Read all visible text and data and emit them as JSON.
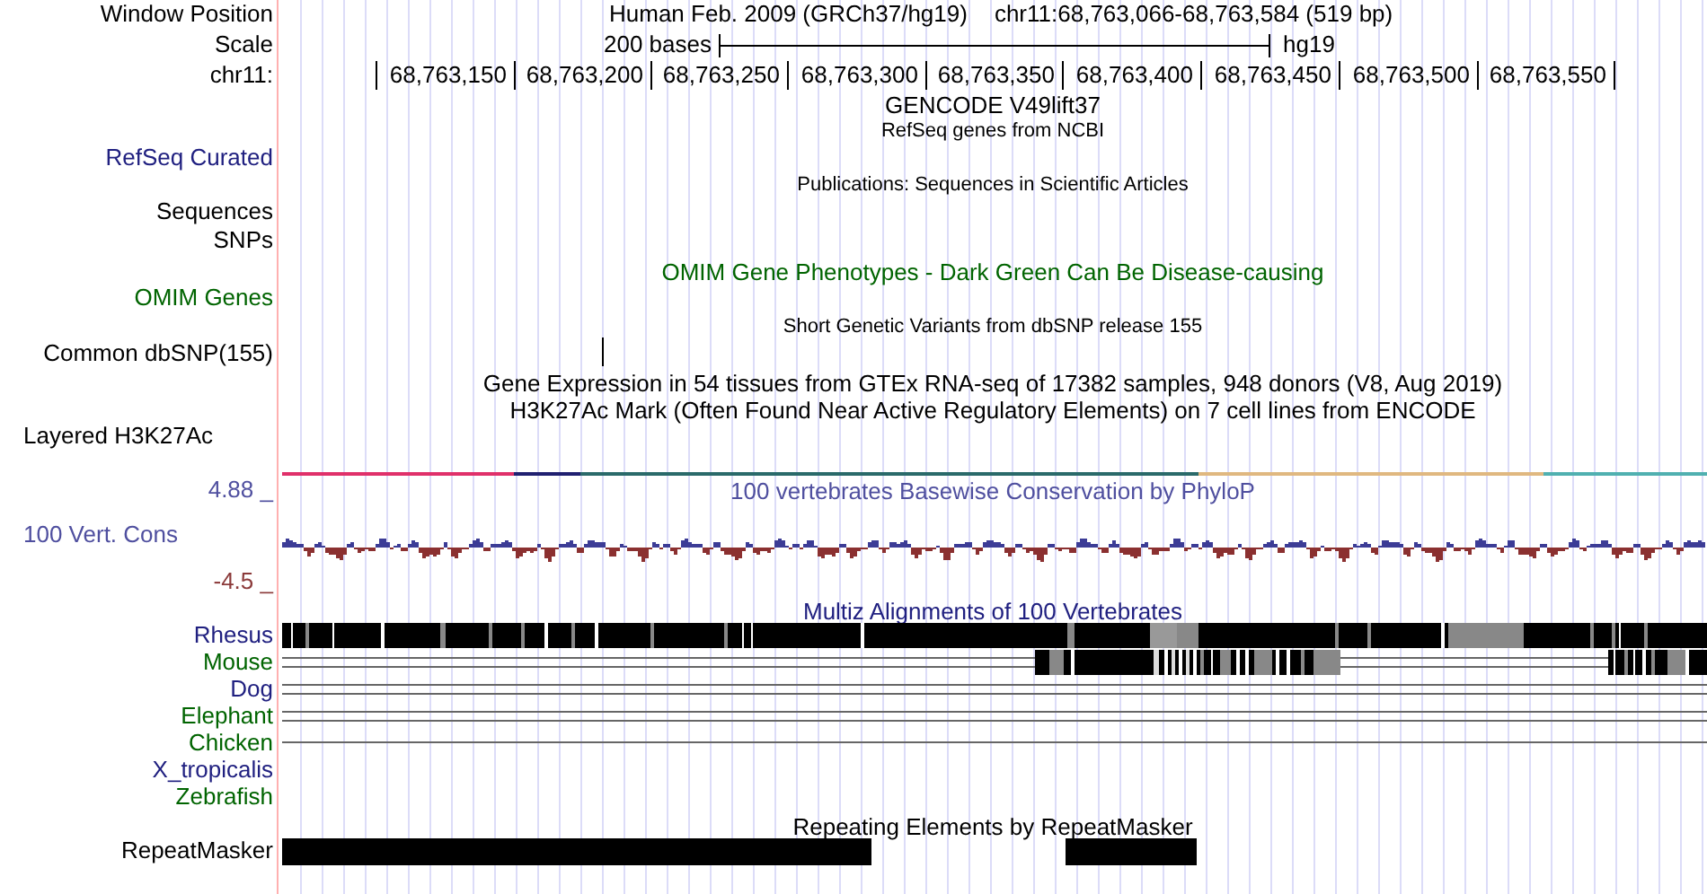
{
  "header": {
    "window_position_label": "Window Position",
    "assembly": "Human Feb. 2009 (GRCh37/hg19)",
    "position": "chr11:68,763,066-68,763,584 (519 bp)",
    "scale_label": "Scale",
    "scale_text": "200 bases",
    "scale_db": "hg19",
    "ruler_label": "chr11:",
    "ruler_ticks": [
      "68,763,150",
      "68,763,200",
      "68,763,250",
      "68,763,300",
      "68,763,350",
      "68,763,400",
      "68,763,450",
      "68,763,500",
      "68,763,550"
    ]
  },
  "track_labels": [
    {
      "text": "RefSeq Curated",
      "color": "#202080"
    },
    {
      "text": "Sequences",
      "color": "#000000"
    },
    {
      "text": "SNPs",
      "color": "#000000"
    },
    {
      "text": "OMIM Genes",
      "color": "#006400"
    },
    {
      "text": "Common dbSNP(155)",
      "color": "#000000"
    },
    {
      "text": "Layered H3K27Ac",
      "color": "#000000"
    },
    {
      "text": "4.88 _",
      "color": "#4f4f9f"
    },
    {
      "text": "100 Vert. Cons",
      "color": "#4f4f9f"
    },
    {
      "text": "-4.5 _",
      "color": "#8b3a3a"
    },
    {
      "text": "Rhesus",
      "color": "#202080"
    },
    {
      "text": "Mouse",
      "color": "#006400"
    },
    {
      "text": "Dog",
      "color": "#202080"
    },
    {
      "text": "Elephant",
      "color": "#006400"
    },
    {
      "text": "Chicken",
      "color": "#006400"
    },
    {
      "text": "X_tropicalis",
      "color": "#202080"
    },
    {
      "text": "Zebrafish",
      "color": "#006400"
    },
    {
      "text": "RepeatMasker",
      "color": "#000000"
    }
  ],
  "track_titles": [
    {
      "text": "GENCODE V49lift37",
      "color": "#000000"
    },
    {
      "text": "RefSeq genes from NCBI",
      "color": "#000000"
    },
    {
      "text": "Publications: Sequences in Scientific Articles",
      "color": "#000000"
    },
    {
      "text": "OMIM Gene Phenotypes - Dark Green Can Be Disease-causing",
      "color": "#006400"
    },
    {
      "text": "Short Genetic Variants from dbSNP release 155",
      "color": "#000000"
    },
    {
      "text": "Gene Expression in 54 tissues from GTEx RNA-seq of 17382 samples, 948 donors (V8, Aug 2019)",
      "color": "#000000"
    },
    {
      "text": "H3K27Ac Mark (Often Found Near Active Regulatory Elements) on 7 cell lines from ENCODE",
      "color": "#000000"
    },
    {
      "text": "100 vertebrates Basewise Conservation by PhyloP",
      "color": "#4f4f9f"
    },
    {
      "text": "Multiz Alignments of 100 Vertebrates",
      "color": "#202080"
    },
    {
      "text": "Repeating Elements by RepeatMasker",
      "color": "#000000"
    }
  ]
}
